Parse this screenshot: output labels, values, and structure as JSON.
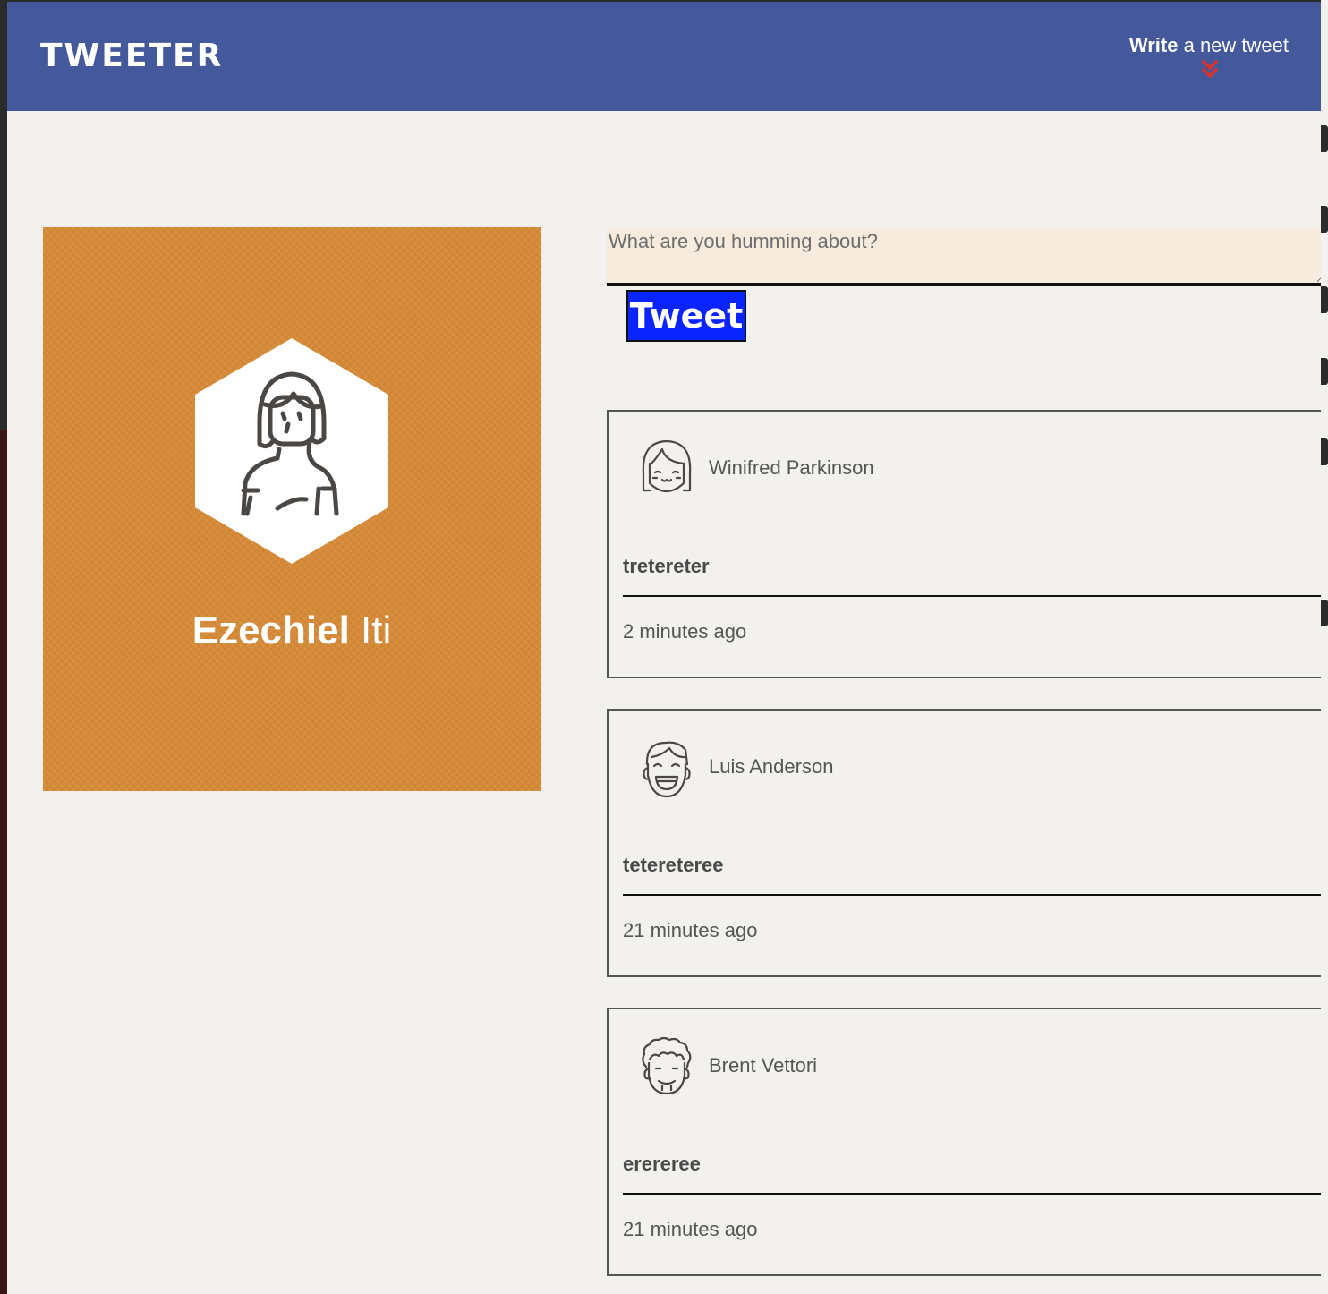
{
  "header": {
    "logo": "TWEETER",
    "write_strong": "Write",
    "write_rest": " a new tweet",
    "chevron_icon": "double-chevron-down-icon",
    "background": "#44589c",
    "chevron_color": "#e0302a"
  },
  "profile": {
    "first_name": "Ezechiel",
    "last_name": " Iti",
    "avatar_icon": "woman-hexagon-avatar-icon",
    "background": "#d68a37"
  },
  "compose": {
    "placeholder": "What are you humming about?",
    "value": "",
    "button_label": "Tweet",
    "button_color": "#0a24ff"
  },
  "tweets": [
    {
      "author": "Winifred Parkinson",
      "text": "tretereter",
      "time": "2 minutes ago",
      "avatar_icon": "girl-bangs-avatar-icon"
    },
    {
      "author": "Luis Anderson",
      "text": "tetereteree",
      "time": "21 minutes ago",
      "avatar_icon": "boy-laughing-avatar-icon"
    },
    {
      "author": "Brent Vettori",
      "text": "erereree",
      "time": "21 minutes ago",
      "avatar_icon": "curly-hair-avatar-icon"
    }
  ]
}
